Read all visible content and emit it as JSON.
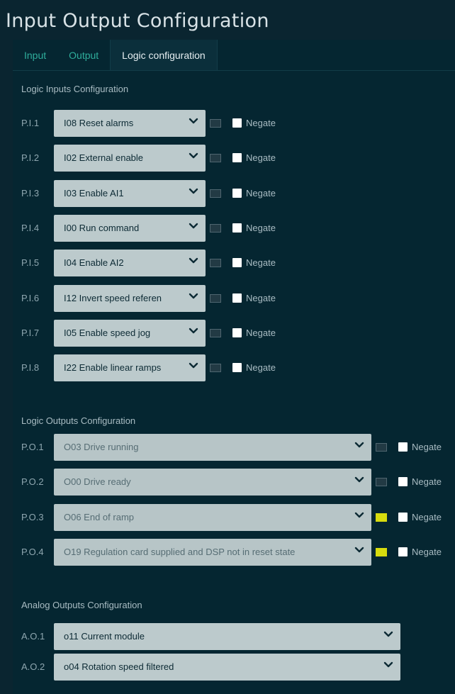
{
  "title": "Input Output Configuration",
  "tabs": [
    "Input",
    "Output",
    "Logic configuration"
  ],
  "logic_inputs": {
    "title": "Logic Inputs Configuration",
    "rows": [
      {
        "label": "P.I.1",
        "value": "I08 Reset alarms"
      },
      {
        "label": "P.I.2",
        "value": "I02 External enable"
      },
      {
        "label": "P.I.3",
        "value": "I03 Enable AI1"
      },
      {
        "label": "P.I.4",
        "value": "I00 Run command"
      },
      {
        "label": "P.I.5",
        "value": "I04 Enable AI2"
      },
      {
        "label": "P.I.6",
        "value": "I12 Invert speed referen"
      },
      {
        "label": "P.I.7",
        "value": "I05 Enable speed jog"
      },
      {
        "label": "P.I.8",
        "value": "I22 Enable linear ramps"
      }
    ]
  },
  "logic_outputs": {
    "title": "Logic Outputs Configuration",
    "rows": [
      {
        "label": "P.O.1",
        "value": "O03 Drive running",
        "state": "off"
      },
      {
        "label": "P.O.2",
        "value": "O00 Drive ready",
        "state": "off"
      },
      {
        "label": "P.O.3",
        "value": "O06 End of ramp",
        "state": "on"
      },
      {
        "label": "P.O.4",
        "value": "O19 Regulation card supplied and DSP not in reset state",
        "state": "on"
      }
    ]
  },
  "analog_outputs": {
    "title": "Analog Outputs Configuration",
    "rows": [
      {
        "label": "A.O.1",
        "value": "o11 Current module"
      },
      {
        "label": "A.O.2",
        "value": "o04 Rotation speed filtered"
      }
    ]
  },
  "negate_label": "Negate",
  "colors": {
    "indicator_on": "#d8dc0e",
    "indicator_off": "#223a44",
    "tab_inactive": "#2fae9c"
  },
  "icons": {
    "dropdown": "chevron-down-icon"
  }
}
